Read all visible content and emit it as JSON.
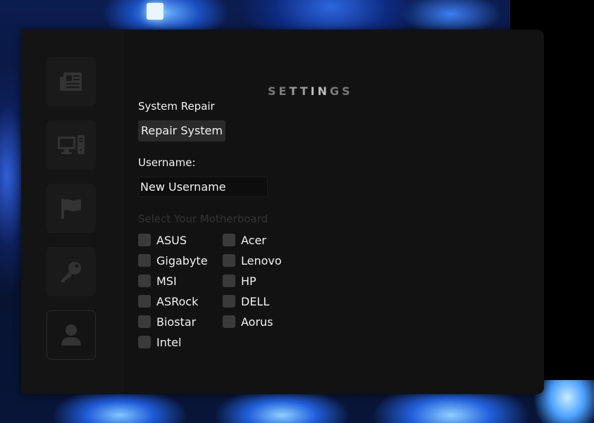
{
  "window": {
    "title": "SETTINGS",
    "title_letters": [
      "S",
      "E",
      "T",
      "T",
      "I",
      "N",
      "G",
      "S"
    ]
  },
  "sidebar": {
    "items": [
      {
        "icon": "newspaper-icon"
      },
      {
        "icon": "desktop-computer-icon"
      },
      {
        "icon": "flag-icon"
      },
      {
        "icon": "key-icon"
      },
      {
        "icon": "user-icon",
        "active": true
      }
    ]
  },
  "system_repair": {
    "label": "System Repair",
    "button_label": "Repair System"
  },
  "username": {
    "label": "Username:",
    "placeholder": "New Username"
  },
  "motherboard": {
    "title": "Select Your Motherboard",
    "column_left": [
      "ASUS",
      "Gigabyte",
      "MSI",
      "ASRock",
      "Biostar",
      "Intel"
    ],
    "column_right": [
      "Acer",
      "Lenovo",
      "HP",
      "DELL",
      "Aorus"
    ]
  },
  "colors": {
    "window_bg": "#121212",
    "sidebar_button_bg": "#1a1a1a",
    "checkbox_bg": "#3a3a3a",
    "text": "#f2f2f2",
    "muted_text": "#343434",
    "accent_wallpaper": "#2160dc"
  }
}
